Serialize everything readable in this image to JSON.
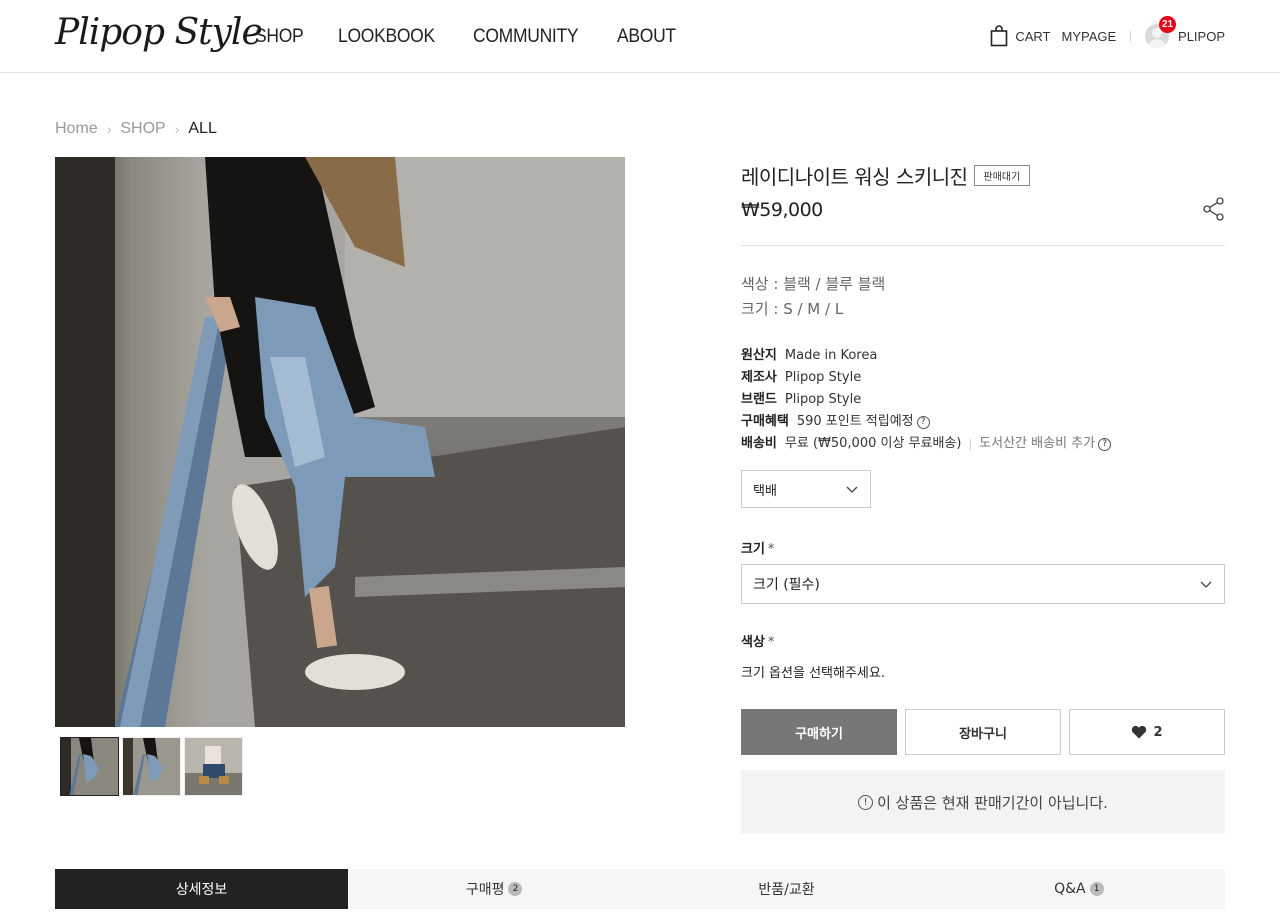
{
  "header": {
    "logo": "Plipop Style",
    "nav": [
      "SHOP",
      "LOOKBOOK",
      "COMMUNITY",
      "ABOUT"
    ],
    "cart_label": "CART",
    "mypage_label": "MYPAGE",
    "user_label": "PLIPOP",
    "notification_count": "21"
  },
  "breadcrumb": [
    "Home",
    "SHOP",
    "ALL"
  ],
  "product": {
    "title": "레이디나이트 워싱 스키니진",
    "status": "판매대기",
    "price": "₩59,000",
    "color_line": "색상 : 블랙 / 블루 블랙",
    "size_line": "크기 : S / M / L",
    "meta": {
      "origin_key": "원산지",
      "origin_val": "Made in Korea",
      "maker_key": "제조사",
      "maker_val": "Plipop Style",
      "brand_key": "브랜드",
      "brand_val": "Plipop Style",
      "benefit_key": "구매혜택",
      "benefit_val": "590 포인트 적립예정",
      "shipping_key": "배송비",
      "shipping_val": "무료 (₩50,000 이상 무료배송)",
      "shipping_extra": "도서산간 배송비 추가"
    },
    "shipping_method": "택배",
    "size_label": "크기",
    "size_placeholder": "크기 (필수)",
    "color_label": "색상",
    "required_mark": "*",
    "color_note": "크기 옵션을 선택해주세요.",
    "buy_label": "구매하기",
    "cart_label": "장바구니",
    "like_count": "2",
    "notice": "이 상품은 현재 판매기간이 아닙니다."
  },
  "tabs": [
    {
      "label": "상세정보"
    },
    {
      "label": "구매평",
      "count": "2"
    },
    {
      "label": "반품/교환"
    },
    {
      "label": "Q&A",
      "count": "1"
    }
  ],
  "colors": {
    "accent_dark": "#222222",
    "buy_button": "#777777",
    "badge": "#e60012"
  },
  "icons": [
    "cart-icon",
    "avatar-icon",
    "share-icon",
    "chevron-down-icon",
    "question-icon",
    "heart-icon",
    "info-icon"
  ]
}
